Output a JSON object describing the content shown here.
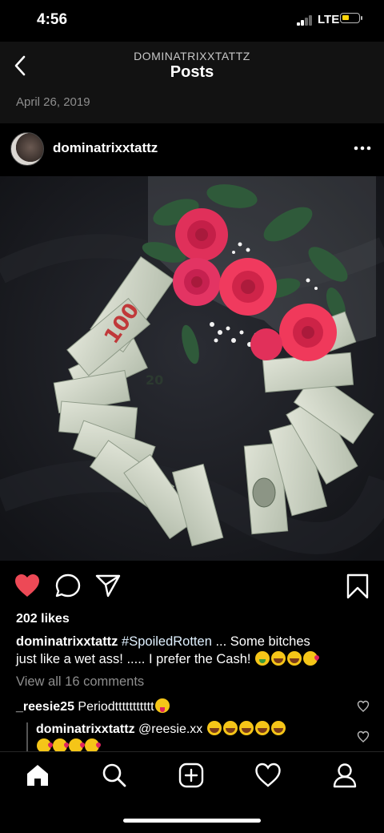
{
  "status": {
    "time": "4:56",
    "network": "LTE"
  },
  "header": {
    "username": "DOMINATRIXXTATTZ",
    "title": "Posts"
  },
  "post": {
    "date": "April 26, 2019",
    "username": "dominatrixxtattz",
    "likes": "202 likes",
    "caption_user": "dominatrixxtattz",
    "caption_hashtag": "#SpoiledRotten",
    "caption_line1": " ... Some bitches",
    "caption_line2": "just  like a wet ass! ..... I prefer the Cash!",
    "view_all": "View all 16 comments",
    "comments": [
      {
        "user": "_reesie25",
        "text": "Periodttttttttttt"
      },
      {
        "user": "dominatrixxtattz",
        "text": "@reesie.xx"
      }
    ],
    "bill_label": "100",
    "bill_label_20": "20"
  },
  "colors": {
    "like": "#ed4956",
    "background": "#000000",
    "muted": "#8e8e8e",
    "battery": "#ffd60a"
  },
  "icons": [
    "back-chevron-icon",
    "more-icon",
    "heart-icon",
    "comment-icon",
    "share-icon",
    "bookmark-icon",
    "home-icon",
    "search-icon",
    "add-icon",
    "activity-icon",
    "profile-icon"
  ]
}
